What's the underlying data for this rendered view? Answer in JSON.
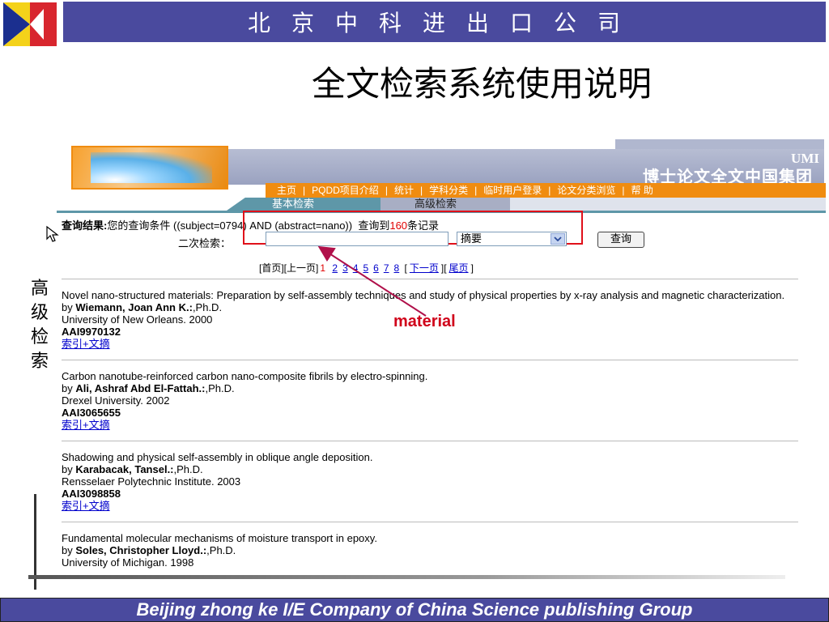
{
  "header": {
    "company": "北京中科进出口公司"
  },
  "slide_title": "全文检索系统使用说明",
  "side_label": "高级检索",
  "footer": "Beijing  zhong ke I/E Company of China Science publishing Group",
  "site": {
    "brand": "UMI",
    "org": "博士论文全文中国集团",
    "nav": [
      "主页",
      "PQDD项目介绍",
      "统计",
      "学科分类",
      "临时用户登录",
      "论文分类浏览",
      "帮 助"
    ],
    "tabs": {
      "basic": "基本检索",
      "advanced": "高级检索"
    },
    "query": {
      "label": "查询结果:",
      "prefix": "您的查询条件",
      "condition": "((subject=0794) AND (abstract=nano))",
      "found_prefix": "查询到",
      "count": "160",
      "found_suffix": "条记录"
    },
    "secondary": {
      "label": "二次检索：",
      "select_value": "摘要",
      "button": "查询"
    },
    "pager": {
      "first": "[首页]",
      "prev": "[上一页]",
      "current": "1",
      "pages": [
        "2",
        "3",
        "4",
        "5",
        "6",
        "7",
        "8"
      ],
      "next": "下一页",
      "last": "尾页"
    },
    "annotation": "material",
    "records": [
      {
        "title": "Novel nano-structured materials: Preparation by self-assembly techniques and study of physical properties by x-ray analysis and magnetic characterization.",
        "by": "by",
        "author": "Wiemann, Joan Ann K.:",
        "degree": ",Ph.D.",
        "school": "University of New Orleans. 2000",
        "aai": "AAI9970132",
        "link": "索引+文摘"
      },
      {
        "title": "Carbon nanotube-reinforced carbon nano-composite fibrils by electro-spinning.",
        "by": "by",
        "author": "Ali, Ashraf Abd El-Fattah.:",
        "degree": ",Ph.D.",
        "school": "Drexel University. 2002",
        "aai": "AAI3065655",
        "link": "索引+文摘"
      },
      {
        "title": "Shadowing and physical self-assembly in oblique angle deposition.",
        "by": "by",
        "author": "Karabacak, Tansel.:",
        "degree": ",Ph.D.",
        "school": "Rensselaer Polytechnic Institute. 2003",
        "aai": "AAI3098858",
        "link": "索引+文摘"
      },
      {
        "title": "Fundamental molecular mechanisms of moisture transport in epoxy.",
        "by": "by",
        "author": "Soles, Christopher Lloyd.:",
        "degree": ",Ph.D.",
        "school": "University of Michigan. 1998",
        "aai": "",
        "link": ""
      }
    ]
  },
  "colors": {
    "header_bg": "#4a4a9e",
    "nav_orange": "#f08c10",
    "tab_teal": "#5e97a8",
    "highlight_red": "#e0101a"
  }
}
